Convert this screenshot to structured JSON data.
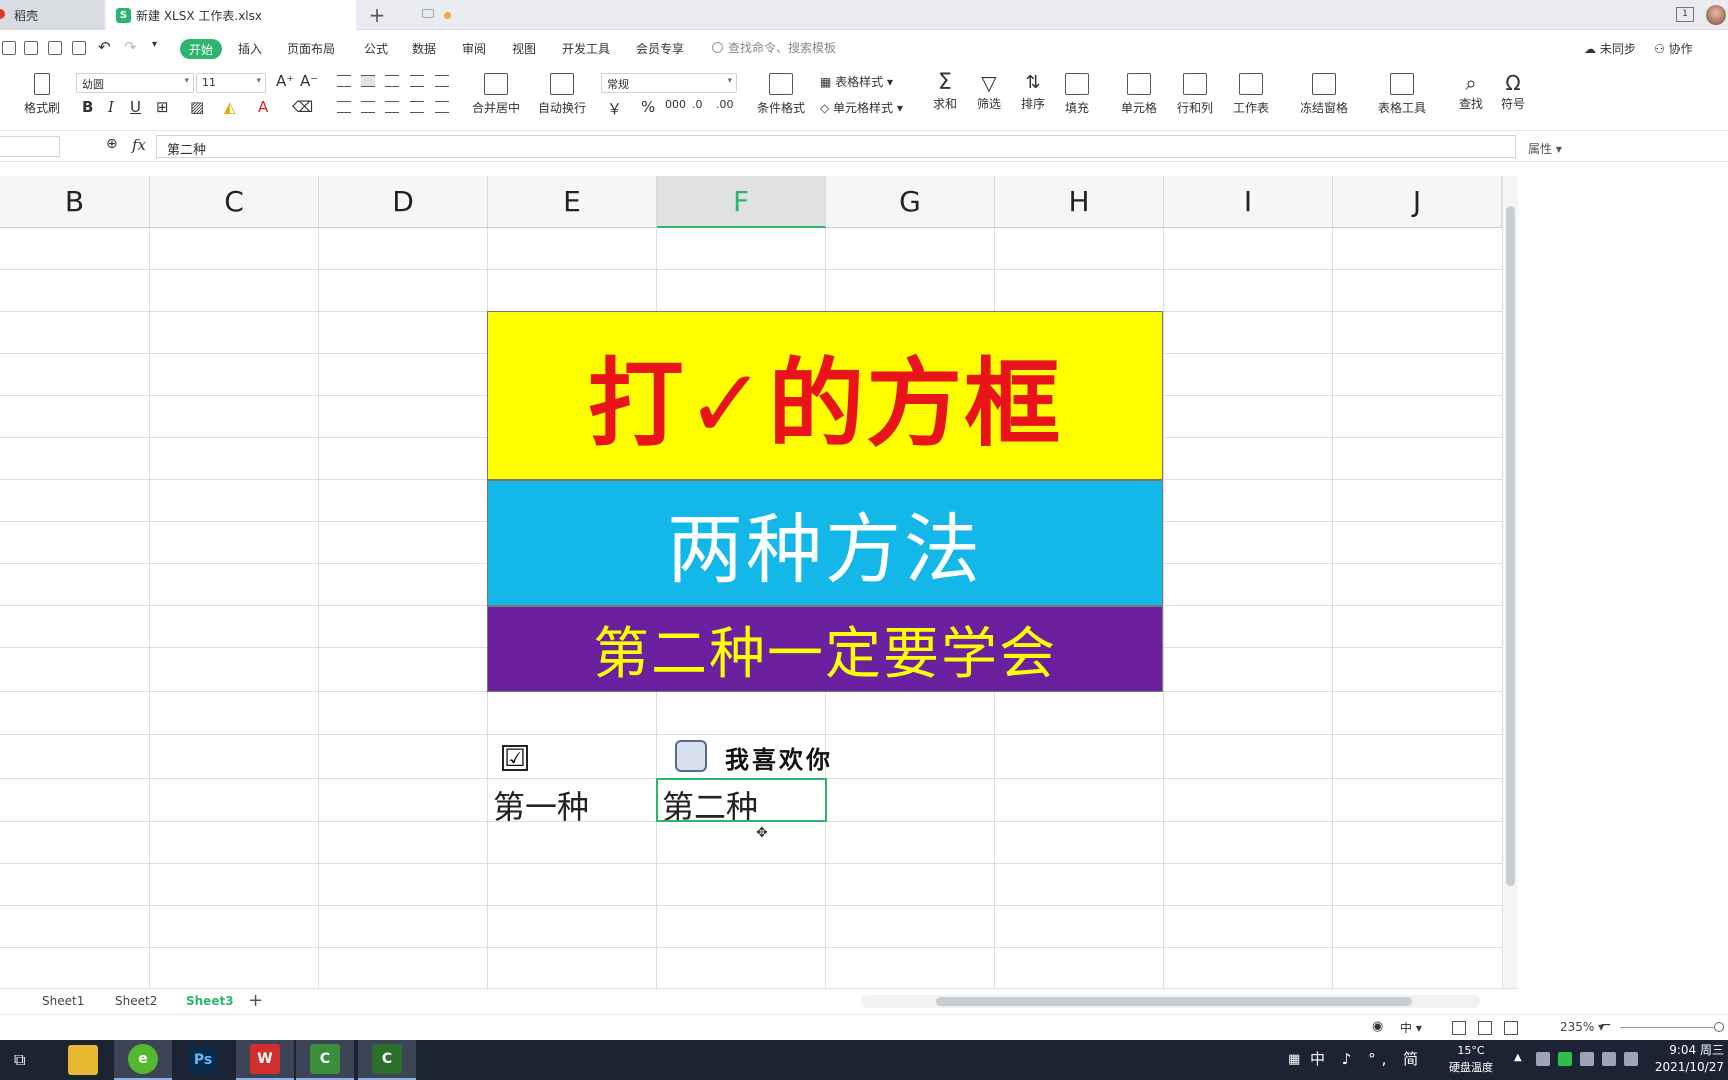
{
  "tabs": [
    {
      "label": "稻壳"
    },
    {
      "label": "新建 XLSX 工作表.xlsx",
      "icon": "S"
    }
  ],
  "menu": {
    "items": [
      "开始",
      "插入",
      "页面布局",
      "公式",
      "数据",
      "审阅",
      "视图",
      "开发工具",
      "会员专享"
    ],
    "search_placeholder": "查找命令、搜索模板",
    "sync": "未同步",
    "collab": "协作"
  },
  "ribbon": {
    "format_painter": "格式刷",
    "font_name": "幼圆",
    "font_size": "11",
    "merge": "合并居中",
    "wrap": "自动换行",
    "number_format": "常规",
    "cond_format": "条件格式",
    "table_style": "表格样式",
    "cell_style": "单元格样式",
    "sum": "求和",
    "filter": "筛选",
    "sort": "排序",
    "fill": "填充",
    "cell": "单元格",
    "rowcol": "行和列",
    "sheet": "工作表",
    "freeze": "冻结窗格",
    "table_tools": "表格工具",
    "find": "查找",
    "symbol": "符号",
    "currency": "￥",
    "percent": "%"
  },
  "formula": {
    "fx": "fx",
    "value": "第二种",
    "props": "属性"
  },
  "columns": [
    "B",
    "C",
    "D",
    "E",
    "F",
    "G",
    "H",
    "I",
    "J"
  ],
  "active_column": "F",
  "cells": {
    "banner1": "打✓的方框",
    "banner2": "两种方法",
    "banner3": "第二种一定要学会",
    "checkbox1_glyph": "☑",
    "checkbox2_label": "我喜欢你",
    "method1": "第一种",
    "method2": "第二种"
  },
  "sheets": [
    "Sheet1",
    "Sheet2",
    "Sheet3"
  ],
  "active_sheet": "Sheet3",
  "status": {
    "zoom": "235%"
  },
  "taskbar": {
    "ime": "中 ♪ °, 简",
    "weather_temp": "15°C",
    "weather_label": "硬盘温度",
    "time": "9:04 周三",
    "date": "2021/10/27"
  },
  "colors": {
    "accent": "#2db56e",
    "banner1_bg": "#ffff00",
    "banner1_text": "#e8141a",
    "banner2_bg": "#13b8e8",
    "banner3_bg": "#6c1f9e",
    "banner3_text": "#ffff00"
  }
}
